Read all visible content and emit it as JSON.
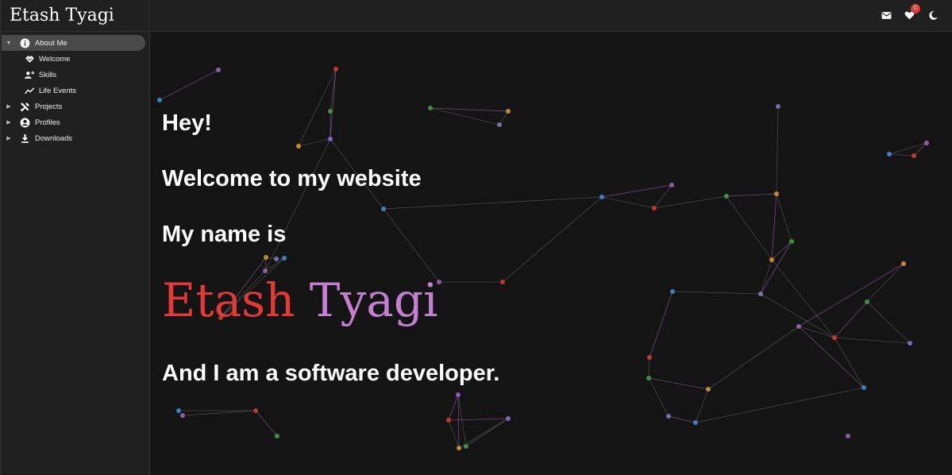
{
  "app": {
    "title": "Etash Tyagi",
    "accent_red": "#e53935",
    "accent_purple": "#c37fd0"
  },
  "sidebar": {
    "items": [
      {
        "label": "About Me",
        "icon": "info-icon",
        "expanded": true,
        "selected": true,
        "children": [
          {
            "label": "Welcome",
            "icon": "handshake-icon"
          },
          {
            "label": "Skills",
            "icon": "person-gear-icon"
          },
          {
            "label": "Life Events",
            "icon": "timeline-icon"
          }
        ]
      },
      {
        "label": "Projects",
        "icon": "tools-icon",
        "expanded": false
      },
      {
        "label": "Profiles",
        "icon": "account-circle-icon",
        "expanded": false
      },
      {
        "label": "Downloads",
        "icon": "download-icon",
        "expanded": false
      }
    ]
  },
  "topbar": {
    "mail_icon": "mail-icon",
    "heart_icon": "heart-icon",
    "heart_badge": "C",
    "theme_icon": "dark-mode-icon"
  },
  "hero": {
    "line1": "Hey!",
    "line2": "Welcome to my website",
    "line3": "My name is",
    "first_name": "Etash",
    "last_name": "Tyagi",
    "line4": "And I am a software developer."
  }
}
